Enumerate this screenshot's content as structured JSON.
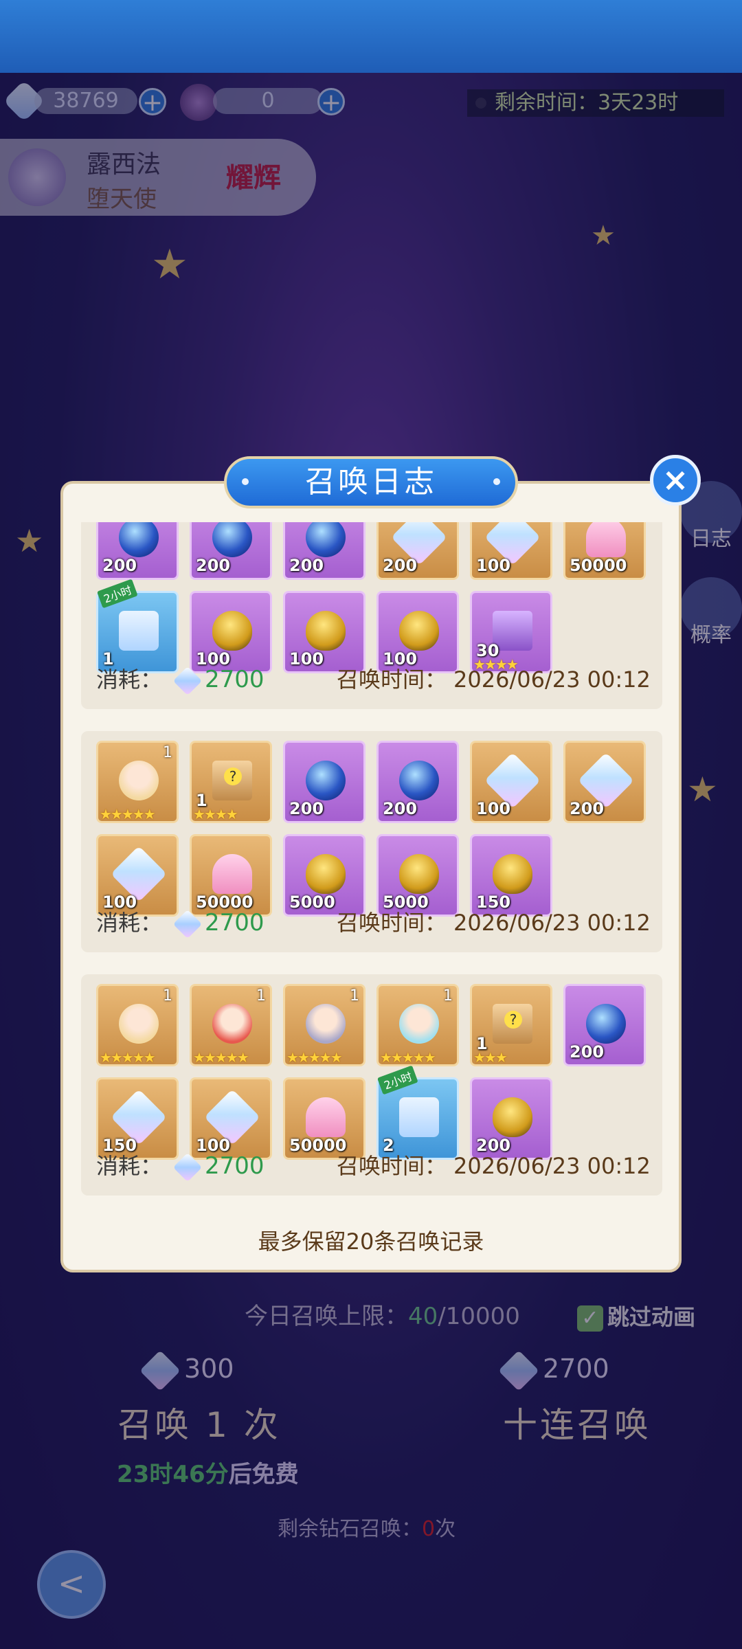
{
  "currency": {
    "crystals": "38769",
    "tickets": "0"
  },
  "timer": {
    "label": "剩余时间：",
    "value": "3天23时"
  },
  "hero": {
    "name": "露西法",
    "title": "堕天使",
    "badge": "耀辉"
  },
  "side": {
    "log": "日志",
    "rate": "概率"
  },
  "modal": {
    "title": "召唤日志",
    "close": "×",
    "footer": "最多保留20条召唤记录",
    "cost_label": "消耗：",
    "time_label": "召唤时间："
  },
  "records": [
    {
      "cost": "2700",
      "time": "2026/06/23 00:12",
      "row1": [
        {
          "type": "orb",
          "bg": "purple",
          "qty": "200"
        },
        {
          "type": "orb",
          "bg": "purple",
          "qty": "200"
        },
        {
          "type": "orb",
          "bg": "purple",
          "qty": "200"
        },
        {
          "type": "crystal",
          "bg": "gold",
          "qty": "200"
        },
        {
          "type": "crystal",
          "bg": "gold",
          "qty": "100"
        },
        {
          "type": "heart",
          "bg": "gold",
          "qty": "50000"
        }
      ],
      "row2": [
        {
          "type": "chest",
          "bg": "blue",
          "qty": "1",
          "ribbon": "2小时"
        },
        {
          "type": "egg",
          "bg": "purple",
          "qty": "100"
        },
        {
          "type": "egg",
          "bg": "purple",
          "qty": "100"
        },
        {
          "type": "egg",
          "bg": "purple",
          "qty": "100"
        },
        {
          "type": "shard",
          "bg": "purple",
          "qty": "30",
          "stars": "★★★★"
        }
      ]
    },
    {
      "cost": "2700",
      "time": "2026/06/23 00:12",
      "row1": [
        {
          "type": "face",
          "bg": "gold",
          "qty": "",
          "stars": "★★★★★",
          "tag": "1",
          "face": "#f4d9a0"
        },
        {
          "type": "box",
          "bg": "gold",
          "qty": "1",
          "stars": "★★★★"
        },
        {
          "type": "orb",
          "bg": "purple",
          "qty": "200"
        },
        {
          "type": "orb",
          "bg": "purple",
          "qty": "200"
        },
        {
          "type": "crystal",
          "bg": "gold",
          "qty": "100"
        },
        {
          "type": "crystal",
          "bg": "gold",
          "qty": "200"
        }
      ],
      "row2": [
        {
          "type": "crystal",
          "bg": "gold",
          "qty": "100"
        },
        {
          "type": "heart",
          "bg": "gold",
          "qty": "50000"
        },
        {
          "type": "egg",
          "bg": "purple",
          "qty": "5000"
        },
        {
          "type": "egg",
          "bg": "purple",
          "qty": "5000"
        },
        {
          "type": "egg",
          "bg": "purple",
          "qty": "150"
        }
      ]
    },
    {
      "cost": "2700",
      "time": "2026/06/23 00:12",
      "row1": [
        {
          "type": "face",
          "bg": "gold",
          "qty": "",
          "stars": "★★★★★",
          "tag": "1",
          "face": "#f4d9a0"
        },
        {
          "type": "face",
          "bg": "gold",
          "qty": "",
          "stars": "★★★★★",
          "tag": "1",
          "face": "#e8584e"
        },
        {
          "type": "face",
          "bg": "gold",
          "qty": "",
          "stars": "★★★★★",
          "tag": "1",
          "face": "#a9a7c9"
        },
        {
          "type": "face",
          "bg": "gold",
          "qty": "",
          "stars": "★★★★★",
          "tag": "1",
          "face": "#9fe0ef"
        },
        {
          "type": "box",
          "bg": "gold",
          "qty": "1",
          "stars": "★★★"
        },
        {
          "type": "orb",
          "bg": "purple",
          "qty": "200"
        }
      ],
      "row2": [
        {
          "type": "crystal",
          "bg": "gold",
          "qty": "150"
        },
        {
          "type": "crystal",
          "bg": "gold",
          "qty": "100"
        },
        {
          "type": "heart",
          "bg": "gold",
          "qty": "50000"
        },
        {
          "type": "chest",
          "bg": "blue",
          "qty": "2",
          "ribbon": "2小时"
        },
        {
          "type": "egg",
          "bg": "purple",
          "qty": "200"
        }
      ]
    }
  ],
  "bottom": {
    "limit_label": "今日召唤上限：",
    "limit_used": "40",
    "limit_max": "/10000",
    "skip": "跳过动画",
    "cost_single": "300",
    "cost_ten": "2700",
    "summon_one": "召唤 1 次",
    "summon_ten": "十连召唤",
    "free_time": "23时46分",
    "free_suffix": "后免费",
    "remain_label": "剩余钻石召唤：",
    "remain_value": "0",
    "remain_suffix": "次"
  }
}
